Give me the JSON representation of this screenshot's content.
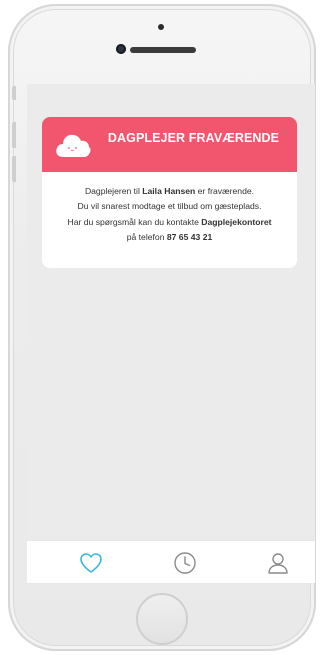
{
  "notice": {
    "title": "DAGPLEJER FRAVÆRENDE",
    "line1_pre": "Dagplejeren til ",
    "line1_name": "Laila Hansen",
    "line1_post": " er fraværende.",
    "line2": "Du vil snarest modtage et tilbud om gæsteplads.",
    "line3_pre": "Har du spørgsmål kan du kontakte ",
    "line3_office": "Dagplejekontoret",
    "line4_pre": "på telefon ",
    "line4_phone": "87 65 43 21"
  },
  "tabbar": {
    "items": [
      {
        "icon": "heart-icon",
        "active": true
      },
      {
        "icon": "clock-icon",
        "active": false
      },
      {
        "icon": "person-icon",
        "active": false
      }
    ]
  },
  "colors": {
    "accent": "#f2566f",
    "active_tab": "#3bb7df",
    "inactive_tab": "#8a8a8a",
    "screen_bg": "#ebebeb"
  }
}
